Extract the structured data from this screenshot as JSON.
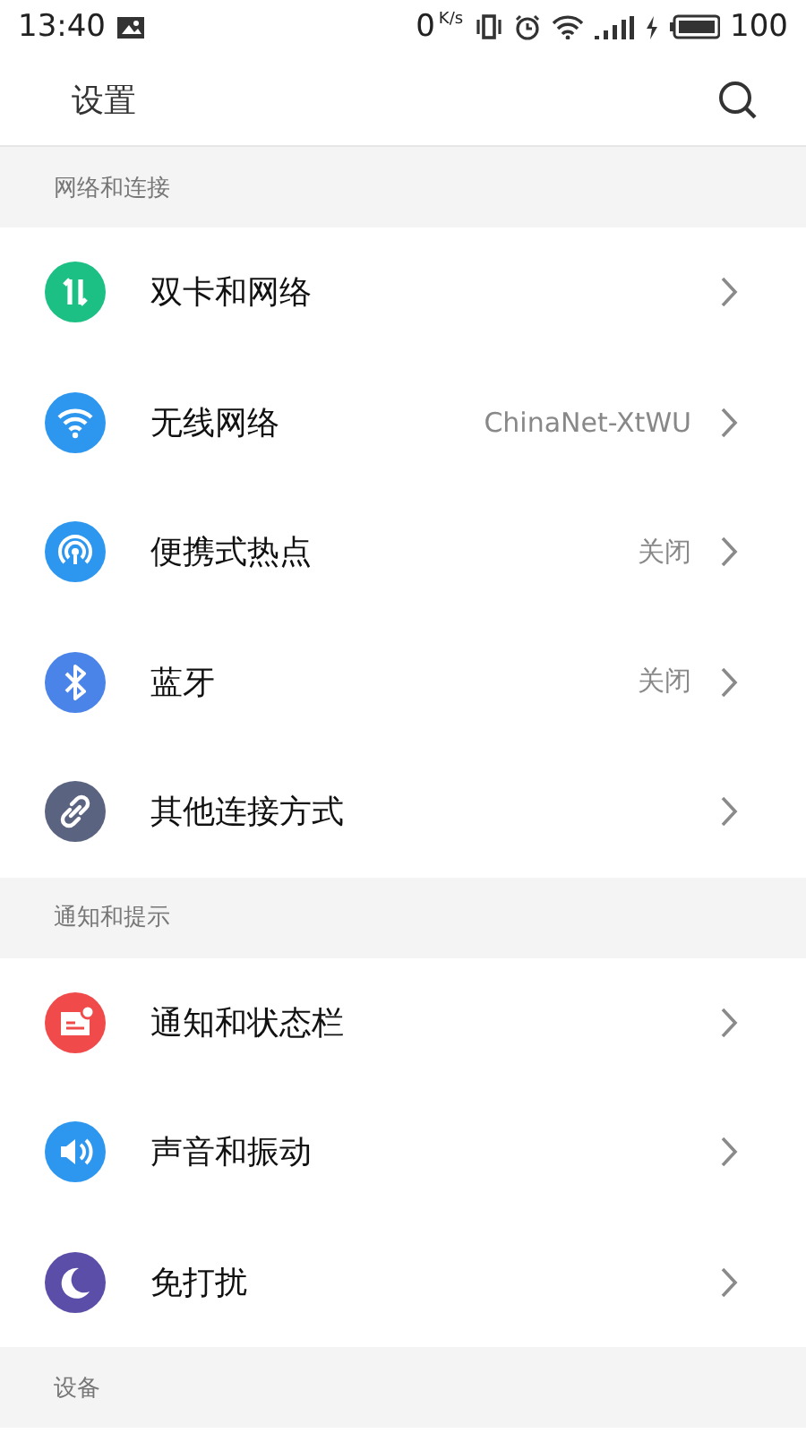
{
  "status_bar": {
    "time": "13:40",
    "speed": "0",
    "speed_unit": "K/s",
    "battery": "100"
  },
  "header": {
    "title": "设置"
  },
  "sections": [
    {
      "title": "网络和连接",
      "items": [
        {
          "kind": "sim",
          "color": "#1cbf84",
          "label": "双卡和网络"
        },
        {
          "kind": "wifi",
          "color": "#2d97f0",
          "label": "无线网络",
          "value": "ChinaNet-XtWU"
        },
        {
          "kind": "hotspot",
          "color": "#2d97f0",
          "label": "便携式热点",
          "value": "关闭"
        },
        {
          "kind": "bluetooth",
          "color": "#4a84e8",
          "label": "蓝牙",
          "value": "关闭"
        },
        {
          "kind": "link",
          "color": "#5a6380",
          "label": "其他连接方式"
        }
      ]
    },
    {
      "title": "通知和提示",
      "items": [
        {
          "kind": "notification",
          "color": "#f04a4a",
          "label": "通知和状态栏"
        },
        {
          "kind": "sound",
          "color": "#2d97f0",
          "label": "声音和振动"
        },
        {
          "kind": "moon",
          "color": "#5a4ea8",
          "label": "免打扰"
        }
      ]
    },
    {
      "title": "设备"
    }
  ]
}
